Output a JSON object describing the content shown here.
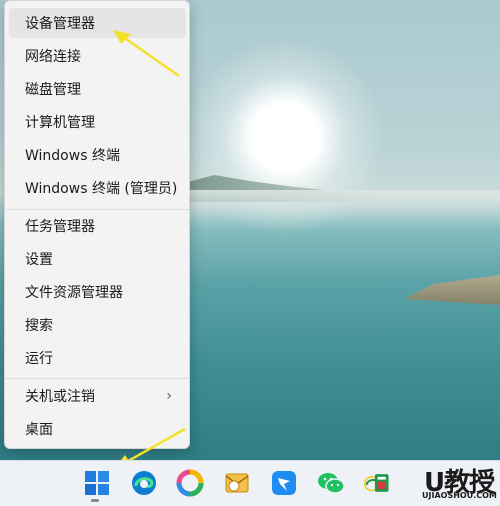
{
  "menu": {
    "items": [
      {
        "label": "设备管理器"
      },
      {
        "label": "网络连接"
      },
      {
        "label": "磁盘管理"
      },
      {
        "label": "计算机管理"
      },
      {
        "label": "Windows 终端"
      },
      {
        "label": "Windows 终端 (管理员)"
      },
      {
        "label": "任务管理器"
      },
      {
        "label": "设置"
      },
      {
        "label": "文件资源管理器"
      },
      {
        "label": "搜索"
      },
      {
        "label": "运行"
      },
      {
        "label": "关机或注销"
      },
      {
        "label": "桌面"
      }
    ],
    "highlighted": "设备管理器",
    "submenu_chevron": "›"
  },
  "taskbar": {
    "icons": [
      "windows-start-icon",
      "edge-icon",
      "photos-icon",
      "outlook-icon",
      "dingtalk-icon",
      "wechat-icon",
      "store-icon"
    ]
  },
  "watermark": {
    "main": "U教授",
    "sub": "UJIAOSHOU.COM"
  },
  "colors": {
    "arrow": "#f5e12a",
    "menu_bg": "#f3f3f3",
    "taskbar_bg": "#eef1f5"
  }
}
